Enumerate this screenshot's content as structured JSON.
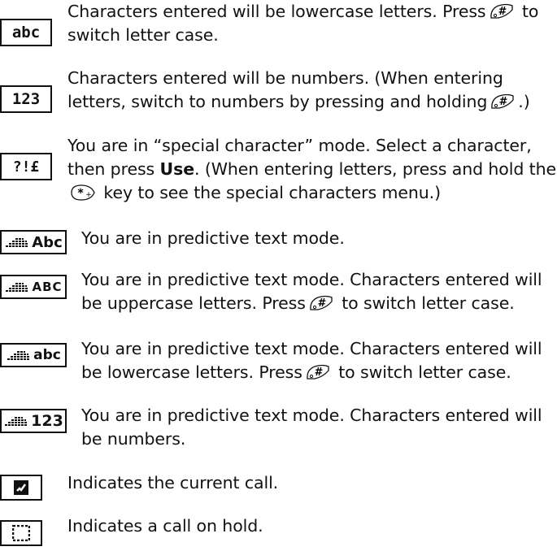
{
  "rows": [
    {
      "icon": "abc-mode-icon",
      "part1": "Characters entered will be lowercase letters. Press",
      "key1": "hash-key",
      "part2": " to switch letter case."
    },
    {
      "icon": "123-mode-icon",
      "part1": "Characters entered will be numbers. (When entering letters, switch to numbers by pressing and holding",
      "key1": "hash-key",
      "part2": ".)"
    },
    {
      "icon": "special-char-mode-icon",
      "part1": "You are in “special character” mode. Select a character, then press ",
      "bold": "Use",
      "part2": ". (When entering letters, press and hold the",
      "key1": "star-key",
      "part3": " key to see the special characters menu.)"
    },
    {
      "icon": "predictive-Abc-icon",
      "text": "You are in predictive text mode."
    },
    {
      "icon": "predictive-ABC-icon",
      "part1": "You are in predictive text mode. Characters entered will be uppercase letters. Press",
      "key1": "hash-key",
      "part2": " to switch letter case."
    },
    {
      "icon": "predictive-abc-icon",
      "part1": "You are in predictive text mode. Characters entered will be lowercase letters. Press",
      "key1": "hash-key",
      "part2": " to switch letter case."
    },
    {
      "icon": "predictive-123-icon",
      "text": "You are in predictive text mode. Characters entered will be numbers."
    },
    {
      "icon": "current-call-icon",
      "text": "Indicates the current call."
    },
    {
      "icon": "call-on-hold-icon",
      "text": "Indicates a call on hold."
    }
  ],
  "icon_labels": {
    "abc": "abc",
    "num": "123",
    "special": "?!£",
    "pAbc": "Abc",
    "pABC": "ABC",
    "pabc": "abc",
    "p123": "123"
  }
}
